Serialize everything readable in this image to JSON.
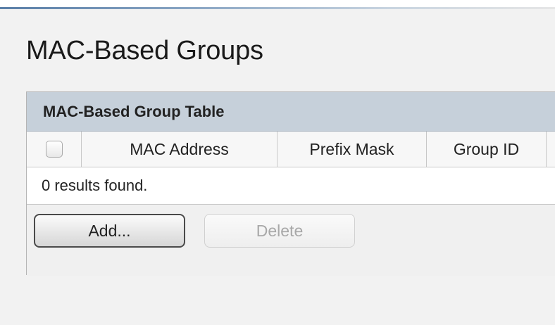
{
  "page": {
    "title": "MAC-Based Groups"
  },
  "table": {
    "title": "MAC-Based Group Table",
    "columns": [
      "MAC Address",
      "Prefix Mask",
      "Group ID"
    ],
    "rows": [],
    "results_text": "0 results found."
  },
  "buttons": {
    "add_label": "Add...",
    "delete_label": "Delete",
    "delete_enabled": false
  },
  "colors": {
    "header_bg": "#c6d0da",
    "page_bg": "#f2f2f2",
    "disabled_text": "#a8a8a8"
  }
}
